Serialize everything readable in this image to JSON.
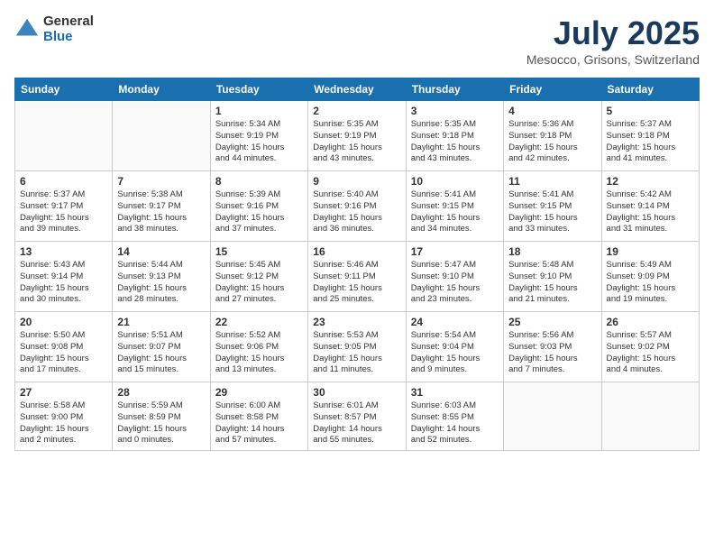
{
  "header": {
    "logo_general": "General",
    "logo_blue": "Blue",
    "month_title": "July 2025",
    "location": "Mesocco, Grisons, Switzerland"
  },
  "weekdays": [
    "Sunday",
    "Monday",
    "Tuesday",
    "Wednesday",
    "Thursday",
    "Friday",
    "Saturday"
  ],
  "weeks": [
    [
      {
        "day": "",
        "content": ""
      },
      {
        "day": "",
        "content": ""
      },
      {
        "day": "1",
        "content": "Sunrise: 5:34 AM\nSunset: 9:19 PM\nDaylight: 15 hours\nand 44 minutes."
      },
      {
        "day": "2",
        "content": "Sunrise: 5:35 AM\nSunset: 9:19 PM\nDaylight: 15 hours\nand 43 minutes."
      },
      {
        "day": "3",
        "content": "Sunrise: 5:35 AM\nSunset: 9:18 PM\nDaylight: 15 hours\nand 43 minutes."
      },
      {
        "day": "4",
        "content": "Sunrise: 5:36 AM\nSunset: 9:18 PM\nDaylight: 15 hours\nand 42 minutes."
      },
      {
        "day": "5",
        "content": "Sunrise: 5:37 AM\nSunset: 9:18 PM\nDaylight: 15 hours\nand 41 minutes."
      }
    ],
    [
      {
        "day": "6",
        "content": "Sunrise: 5:37 AM\nSunset: 9:17 PM\nDaylight: 15 hours\nand 39 minutes."
      },
      {
        "day": "7",
        "content": "Sunrise: 5:38 AM\nSunset: 9:17 PM\nDaylight: 15 hours\nand 38 minutes."
      },
      {
        "day": "8",
        "content": "Sunrise: 5:39 AM\nSunset: 9:16 PM\nDaylight: 15 hours\nand 37 minutes."
      },
      {
        "day": "9",
        "content": "Sunrise: 5:40 AM\nSunset: 9:16 PM\nDaylight: 15 hours\nand 36 minutes."
      },
      {
        "day": "10",
        "content": "Sunrise: 5:41 AM\nSunset: 9:15 PM\nDaylight: 15 hours\nand 34 minutes."
      },
      {
        "day": "11",
        "content": "Sunrise: 5:41 AM\nSunset: 9:15 PM\nDaylight: 15 hours\nand 33 minutes."
      },
      {
        "day": "12",
        "content": "Sunrise: 5:42 AM\nSunset: 9:14 PM\nDaylight: 15 hours\nand 31 minutes."
      }
    ],
    [
      {
        "day": "13",
        "content": "Sunrise: 5:43 AM\nSunset: 9:14 PM\nDaylight: 15 hours\nand 30 minutes."
      },
      {
        "day": "14",
        "content": "Sunrise: 5:44 AM\nSunset: 9:13 PM\nDaylight: 15 hours\nand 28 minutes."
      },
      {
        "day": "15",
        "content": "Sunrise: 5:45 AM\nSunset: 9:12 PM\nDaylight: 15 hours\nand 27 minutes."
      },
      {
        "day": "16",
        "content": "Sunrise: 5:46 AM\nSunset: 9:11 PM\nDaylight: 15 hours\nand 25 minutes."
      },
      {
        "day": "17",
        "content": "Sunrise: 5:47 AM\nSunset: 9:10 PM\nDaylight: 15 hours\nand 23 minutes."
      },
      {
        "day": "18",
        "content": "Sunrise: 5:48 AM\nSunset: 9:10 PM\nDaylight: 15 hours\nand 21 minutes."
      },
      {
        "day": "19",
        "content": "Sunrise: 5:49 AM\nSunset: 9:09 PM\nDaylight: 15 hours\nand 19 minutes."
      }
    ],
    [
      {
        "day": "20",
        "content": "Sunrise: 5:50 AM\nSunset: 9:08 PM\nDaylight: 15 hours\nand 17 minutes."
      },
      {
        "day": "21",
        "content": "Sunrise: 5:51 AM\nSunset: 9:07 PM\nDaylight: 15 hours\nand 15 minutes."
      },
      {
        "day": "22",
        "content": "Sunrise: 5:52 AM\nSunset: 9:06 PM\nDaylight: 15 hours\nand 13 minutes."
      },
      {
        "day": "23",
        "content": "Sunrise: 5:53 AM\nSunset: 9:05 PM\nDaylight: 15 hours\nand 11 minutes."
      },
      {
        "day": "24",
        "content": "Sunrise: 5:54 AM\nSunset: 9:04 PM\nDaylight: 15 hours\nand 9 minutes."
      },
      {
        "day": "25",
        "content": "Sunrise: 5:56 AM\nSunset: 9:03 PM\nDaylight: 15 hours\nand 7 minutes."
      },
      {
        "day": "26",
        "content": "Sunrise: 5:57 AM\nSunset: 9:02 PM\nDaylight: 15 hours\nand 4 minutes."
      }
    ],
    [
      {
        "day": "27",
        "content": "Sunrise: 5:58 AM\nSunset: 9:00 PM\nDaylight: 15 hours\nand 2 minutes."
      },
      {
        "day": "28",
        "content": "Sunrise: 5:59 AM\nSunset: 8:59 PM\nDaylight: 15 hours\nand 0 minutes."
      },
      {
        "day": "29",
        "content": "Sunrise: 6:00 AM\nSunset: 8:58 PM\nDaylight: 14 hours\nand 57 minutes."
      },
      {
        "day": "30",
        "content": "Sunrise: 6:01 AM\nSunset: 8:57 PM\nDaylight: 14 hours\nand 55 minutes."
      },
      {
        "day": "31",
        "content": "Sunrise: 6:03 AM\nSunset: 8:55 PM\nDaylight: 14 hours\nand 52 minutes."
      },
      {
        "day": "",
        "content": ""
      },
      {
        "day": "",
        "content": ""
      }
    ]
  ]
}
